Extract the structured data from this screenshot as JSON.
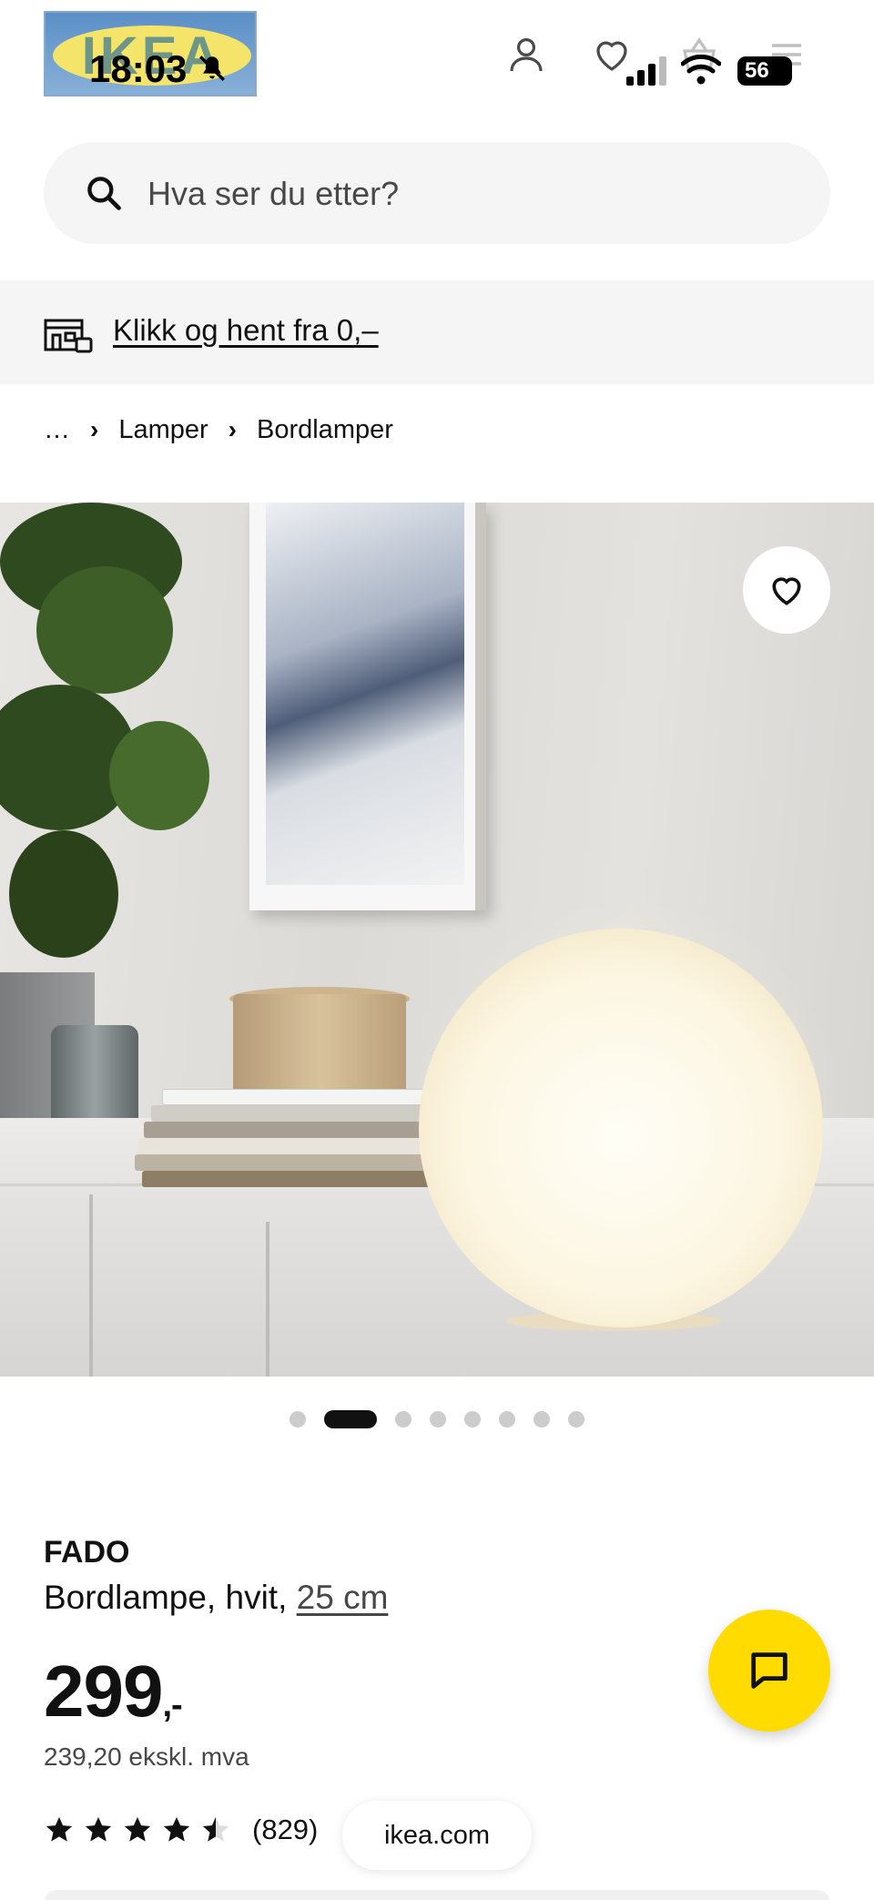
{
  "status_bar": {
    "time": "18:03",
    "battery": "56"
  },
  "header": {
    "logo_text": "IKEA",
    "icons": [
      "account-icon",
      "wishlist-icon",
      "basket-icon",
      "menu-icon"
    ]
  },
  "search": {
    "placeholder": "Hva ser du etter?"
  },
  "collect": {
    "label": "Klikk og hent fra 0,–"
  },
  "breadcrumb": {
    "items": [
      "…",
      "Lamper",
      "Bordlamper"
    ]
  },
  "gallery": {
    "dot_count": 8,
    "active_index": 1
  },
  "product": {
    "name": "FADO",
    "description": "Bordlampe, hvit, ",
    "size": "25 cm",
    "price": "299",
    "price_suffix": ",-",
    "price_ex_vat": "239,20 ekskl. mva",
    "rating_value": 4.5,
    "review_count": "(829)"
  },
  "browser": {
    "domain": "ikea.com"
  },
  "colors": {
    "accent_yellow": "#ffdb00",
    "ikea_blue": "#0058a3",
    "text": "#111111",
    "muted": "#484848"
  }
}
